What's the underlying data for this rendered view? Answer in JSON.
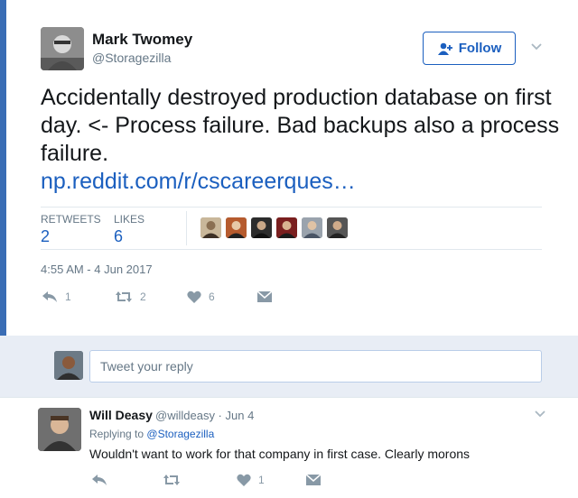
{
  "tweet": {
    "author_name": "Mark Twomey",
    "author_handle": "@Storagezilla",
    "follow_label": "Follow",
    "text": "Accidentally destroyed production database on first day. <- Process failure. Bad backups also a process failure.",
    "link": "np.reddit.com/r/cscareerques…",
    "retweets_label": "RETWEETS",
    "retweets_count": "2",
    "likes_label": "LIKES",
    "likes_count": "6",
    "timestamp": "4:55 AM - 4 Jun 2017",
    "actions": {
      "reply_count": "1",
      "retweet_count": "2",
      "like_count": "6"
    }
  },
  "reply_composer": {
    "placeholder": "Tweet your reply"
  },
  "reply": {
    "author_name": "Will Deasy",
    "meta": "@willdeasy · Jun 4",
    "replying_prefix": "Replying to",
    "replying_to": "@Storagezilla",
    "text": "Wouldn't want to work for that company in first case. Clearly morons",
    "like_count": "1"
  },
  "colors": {
    "link": "#1b5fbf",
    "muted": "#657786",
    "icon": "#8899a6",
    "reply_bar": "#e8edf5"
  },
  "icons": [
    "person-add-icon",
    "chevron-down-icon",
    "reply-icon",
    "retweet-icon",
    "heart-icon",
    "message-icon"
  ]
}
